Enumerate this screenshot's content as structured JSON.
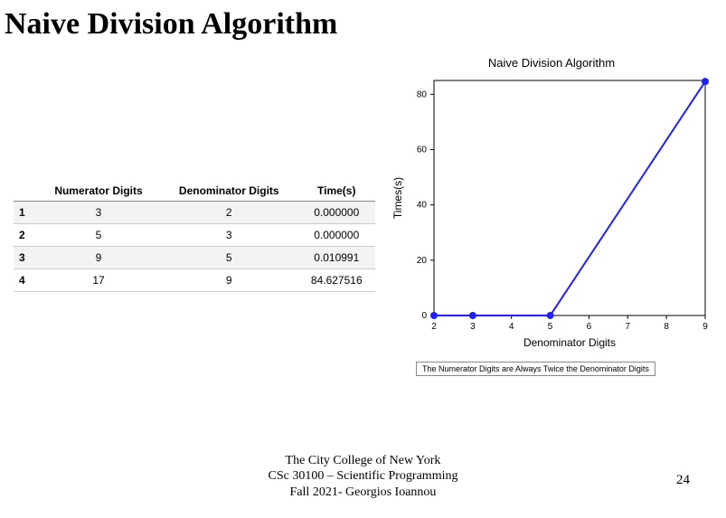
{
  "title": "Naive Division Algorithm",
  "table": {
    "headers": [
      "",
      "Numerator Digits",
      "Denominator Digits",
      "Time(s)"
    ],
    "rows": [
      {
        "idx": "1",
        "num": "3",
        "den": "2",
        "time": "0.000000"
      },
      {
        "idx": "2",
        "num": "5",
        "den": "3",
        "time": "0.000000"
      },
      {
        "idx": "3",
        "num": "9",
        "den": "5",
        "time": "0.010991"
      },
      {
        "idx": "4",
        "num": "17",
        "den": "9",
        "time": "84.627516"
      }
    ]
  },
  "chart_data": {
    "type": "line",
    "title": "Naive Division Algorithm",
    "xlabel": "Denominator Digits",
    "ylabel": "Times(s)",
    "x": [
      2,
      3,
      5,
      9
    ],
    "y": [
      0.0,
      0.0,
      0.010991,
      84.627516
    ],
    "xlim": [
      2,
      9
    ],
    "ylim": [
      0,
      85
    ],
    "xticks": [
      2,
      3,
      4,
      5,
      6,
      7,
      8,
      9
    ],
    "yticks": [
      0,
      20,
      40,
      60,
      80
    ],
    "caption": "The Numerator Digits are Always Twice the Denominator Digits"
  },
  "footer": {
    "line1": "The City College of New York",
    "line2": "CSc 30100 – Scientific Programming",
    "line3": "Fall 2021- Georgios Ioannou"
  },
  "page_num": "24"
}
